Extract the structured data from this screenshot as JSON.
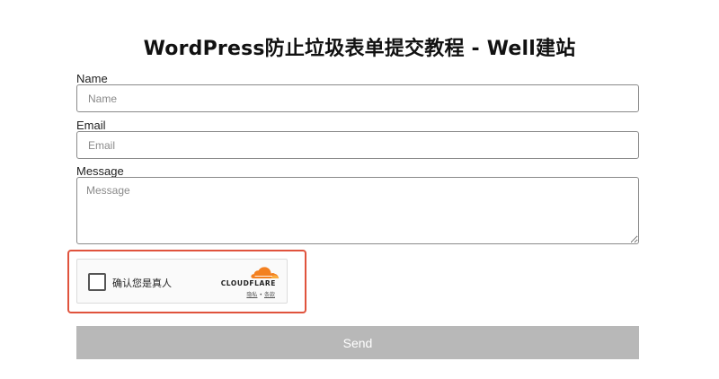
{
  "page": {
    "title": "WordPress防止垃圾表单提交教程 - Well建站"
  },
  "form": {
    "name": {
      "label": "Name",
      "placeholder": "Name",
      "value": ""
    },
    "email": {
      "label": "Email",
      "placeholder": "Email",
      "value": ""
    },
    "message": {
      "label": "Message",
      "placeholder": "Message",
      "value": ""
    },
    "send_label": "Send"
  },
  "turnstile": {
    "checked": false,
    "label": "确认您是真人",
    "brand": "CLOUDFLARE",
    "privacy_link": "隐私",
    "separator": "•",
    "terms_link": "条款",
    "brand_color": "#f38020",
    "highlight_color": "#e0533d"
  },
  "colors": {
    "button_bg": "#b8b8b8",
    "input_border": "#8a8a8a"
  }
}
